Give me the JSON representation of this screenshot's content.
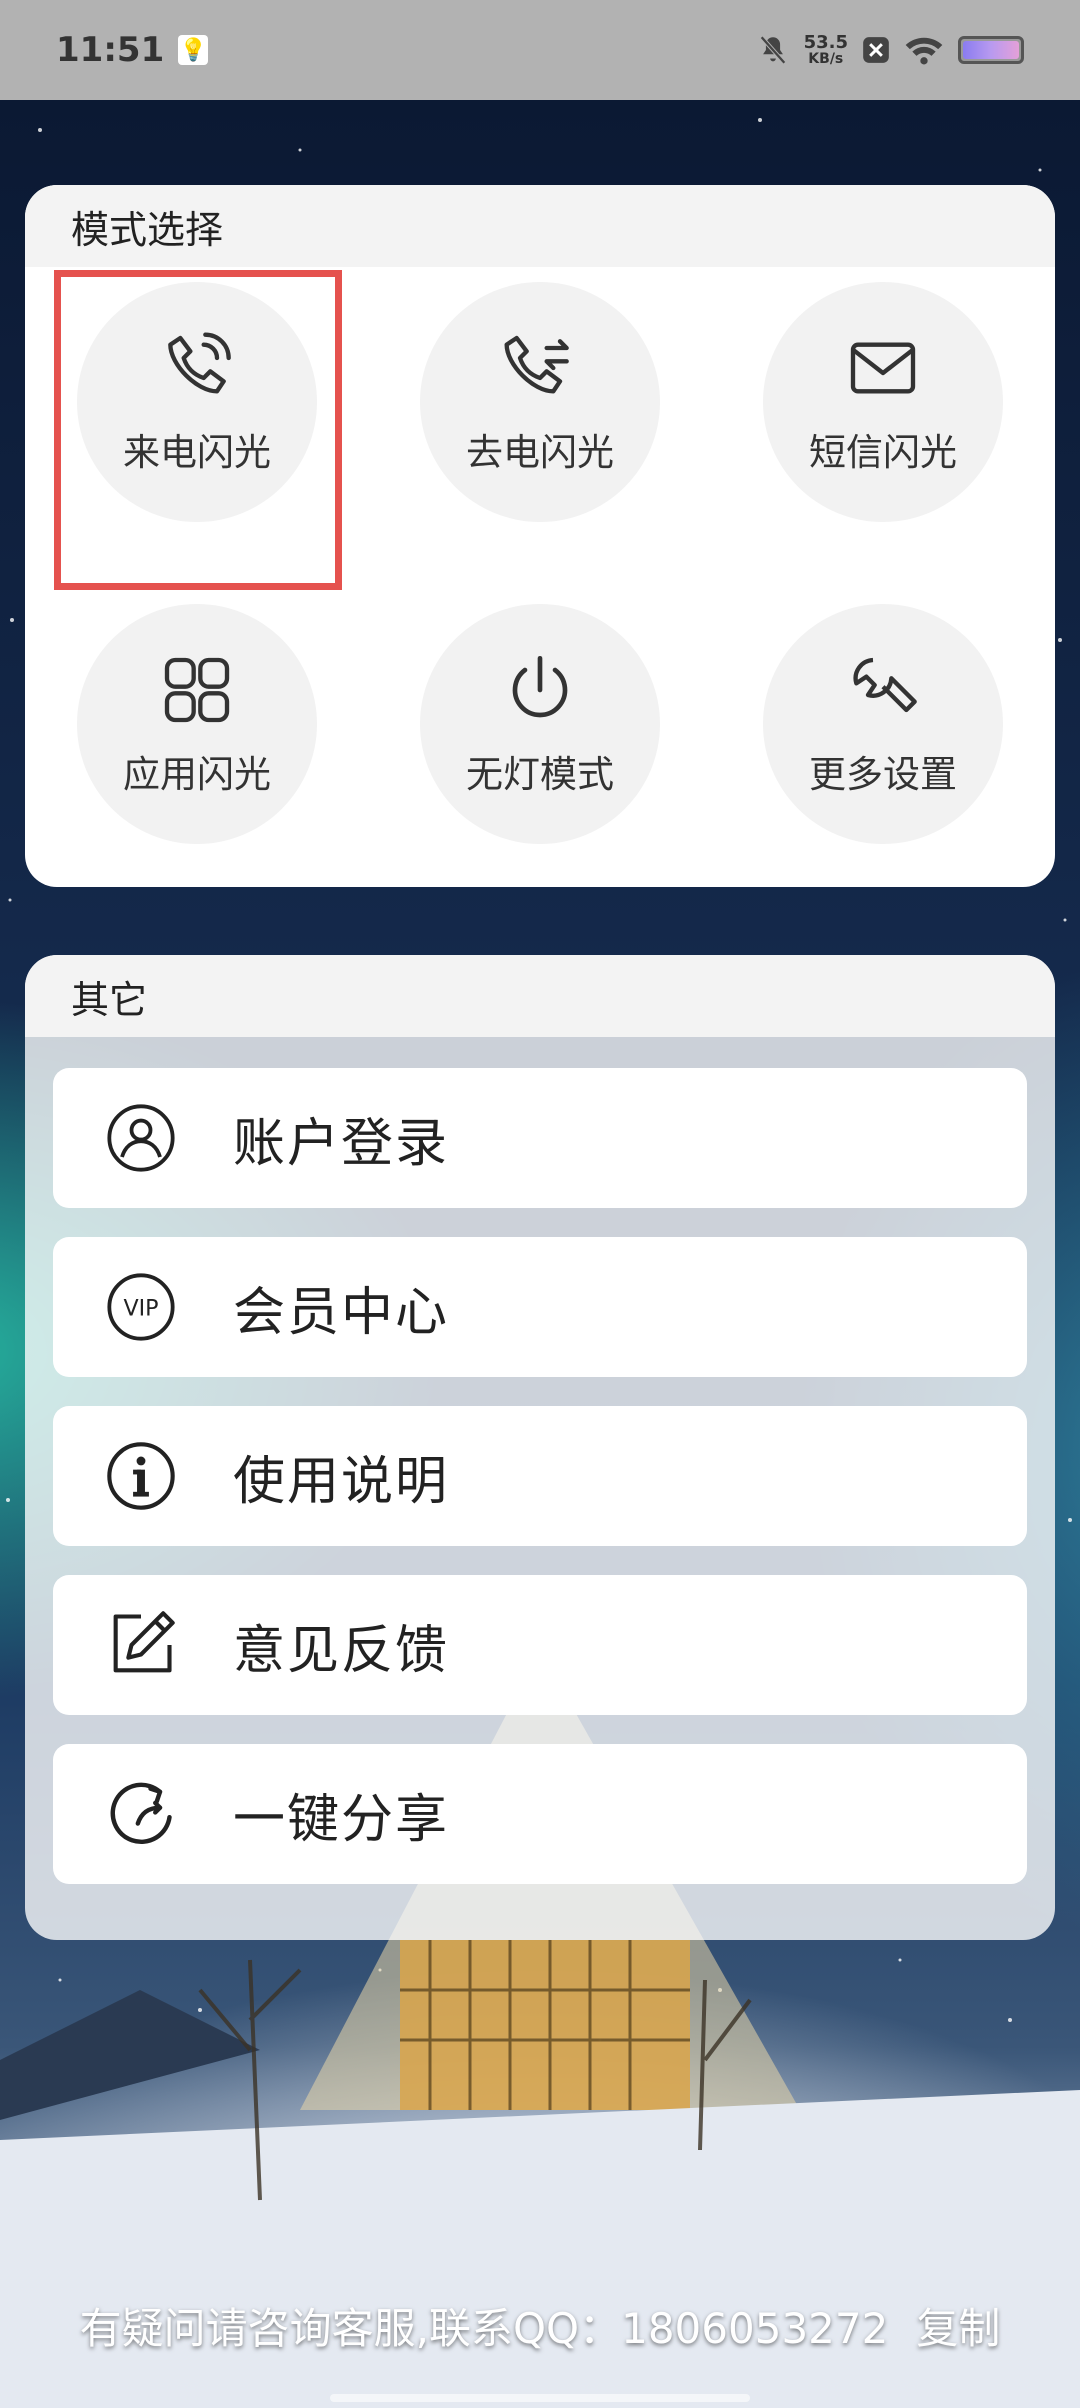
{
  "status_bar": {
    "time": "11:51",
    "net_speed_value": "53.5",
    "net_speed_unit": "KB/s",
    "icons": [
      "bulb-icon",
      "mute-icon",
      "close-box-icon",
      "wifi-icon",
      "battery-icon"
    ]
  },
  "mode_section": {
    "title": "模式选择",
    "items": [
      {
        "label": "来电闪光",
        "icon": "incoming-call-icon"
      },
      {
        "label": "去电闪光",
        "icon": "outgoing-call-icon"
      },
      {
        "label": "短信闪光",
        "icon": "envelope-icon"
      },
      {
        "label": "应用闪光",
        "icon": "apps-grid-icon"
      },
      {
        "label": "无灯模式",
        "icon": "power-icon"
      },
      {
        "label": "更多设置",
        "icon": "wrench-icon"
      }
    ],
    "selected_index": 0,
    "highlight_color": "#e5524e"
  },
  "other_section": {
    "title": "其它",
    "items": [
      {
        "label": "账户登录",
        "icon": "user-icon"
      },
      {
        "label": "会员中心",
        "icon": "vip-icon"
      },
      {
        "label": "使用说明",
        "icon": "info-icon"
      },
      {
        "label": "意见反馈",
        "icon": "edit-icon"
      },
      {
        "label": "一键分享",
        "icon": "share-icon"
      }
    ]
  },
  "footer": {
    "message": "有疑问请咨询客服,联系QQ：1806053272",
    "copy_label": "复制"
  }
}
